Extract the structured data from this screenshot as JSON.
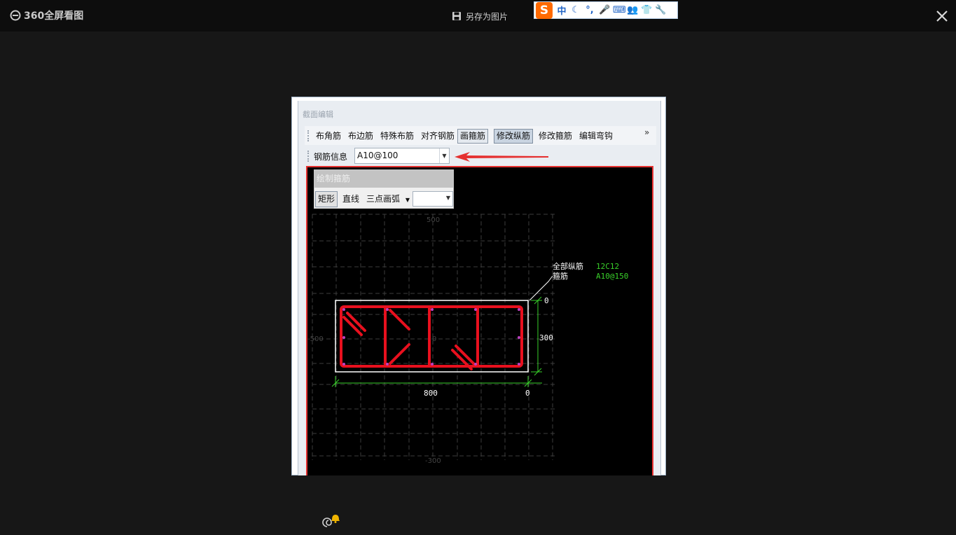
{
  "topbar": {
    "app_title": "360全屏看图",
    "save_label": "另存为图片"
  },
  "ime": {
    "logo": "S",
    "items": [
      "中",
      "☾",
      "°,",
      "🎤",
      "⌨",
      "👥",
      "👕",
      "🔧"
    ]
  },
  "window": {
    "title": "截面编辑",
    "toolbar": {
      "items": [
        "布角筋",
        "布边筋",
        "特殊布筋",
        "对齐钢筋",
        "画箍筋",
        "修改纵筋",
        "修改箍筋",
        "编辑弯钩"
      ],
      "more": "»"
    },
    "rebar_info": {
      "label": "钢筋信息",
      "value": "A10@100"
    },
    "draw_panel": {
      "title": "绘制箍筋",
      "items": [
        "矩形",
        "直线",
        "三点画弧"
      ],
      "combo_value": ""
    },
    "drawing": {
      "annotation_lines": [
        "全部纵筋",
        "箍筋"
      ],
      "annotation_values": [
        "12C12",
        "A10@150"
      ],
      "dim_width": "800",
      "dim_height": "300",
      "dim_zero_top": "0",
      "dim_zero_bottom": "0",
      "grid_label_top": "500",
      "grid_label_left": "-500",
      "grid_label_bottom": "-300",
      "grid_label_center": "0"
    }
  },
  "colors": {
    "rebar": "#e8101e",
    "dimension": "#39d02a",
    "section_outline": "#ffffff",
    "canvas_border": "#e53030",
    "arrow": "#e53030"
  }
}
